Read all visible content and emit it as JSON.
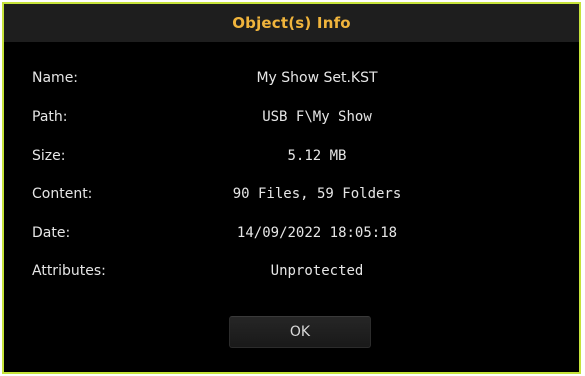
{
  "dialog": {
    "title": "Object(s) Info",
    "border_color": "#c6e33a",
    "title_color": "#f0b43c",
    "fields": [
      {
        "label": "Name:",
        "value": "My Show Set.KST"
      },
      {
        "label": "Path:",
        "value": "USB F\\My Show"
      },
      {
        "label": "Size:",
        "value": "5.12 MB"
      },
      {
        "label": "Content:",
        "value": "90 Files, 59 Folders"
      },
      {
        "label": "Date:",
        "value": "14/09/2022 18:05:18"
      },
      {
        "label": "Attributes:",
        "value": "Unprotected"
      }
    ],
    "ok_label": "OK"
  }
}
